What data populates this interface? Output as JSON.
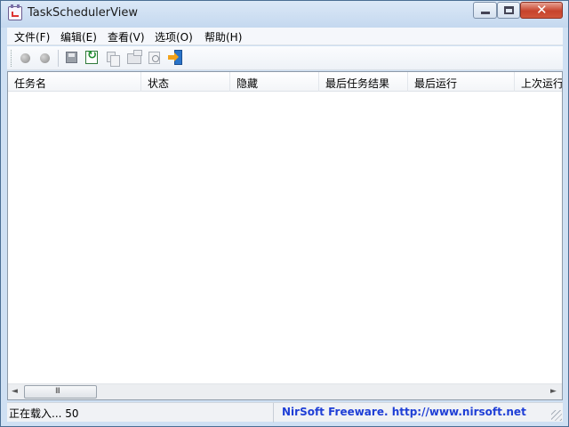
{
  "window": {
    "title": "TaskSchedulerView"
  },
  "menu": {
    "items": [
      {
        "label": "文件(F)"
      },
      {
        "label": "编辑(E)"
      },
      {
        "label": "查看(V)"
      },
      {
        "label": "选项(O)"
      },
      {
        "label": "帮助(H)"
      }
    ]
  },
  "toolbar": {
    "buttons": [
      {
        "icon": "gray-circle-icon"
      },
      {
        "icon": "gray-circle-icon"
      },
      {
        "icon": "save-icon"
      },
      {
        "icon": "refresh-icon"
      },
      {
        "icon": "copy-icon"
      },
      {
        "icon": "properties-icon"
      },
      {
        "icon": "find-icon"
      },
      {
        "icon": "exit-icon"
      }
    ]
  },
  "list": {
    "columns": [
      {
        "label": "任务名"
      },
      {
        "label": "状态"
      },
      {
        "label": "隐藏"
      },
      {
        "label": "最后任务结果"
      },
      {
        "label": "最后运行"
      },
      {
        "label": "上次运行"
      }
    ],
    "scroll_grip": "III"
  },
  "status": {
    "text": "正在载入... 50",
    "link": "NirSoft Freeware.  http://www.nirsoft.net"
  }
}
